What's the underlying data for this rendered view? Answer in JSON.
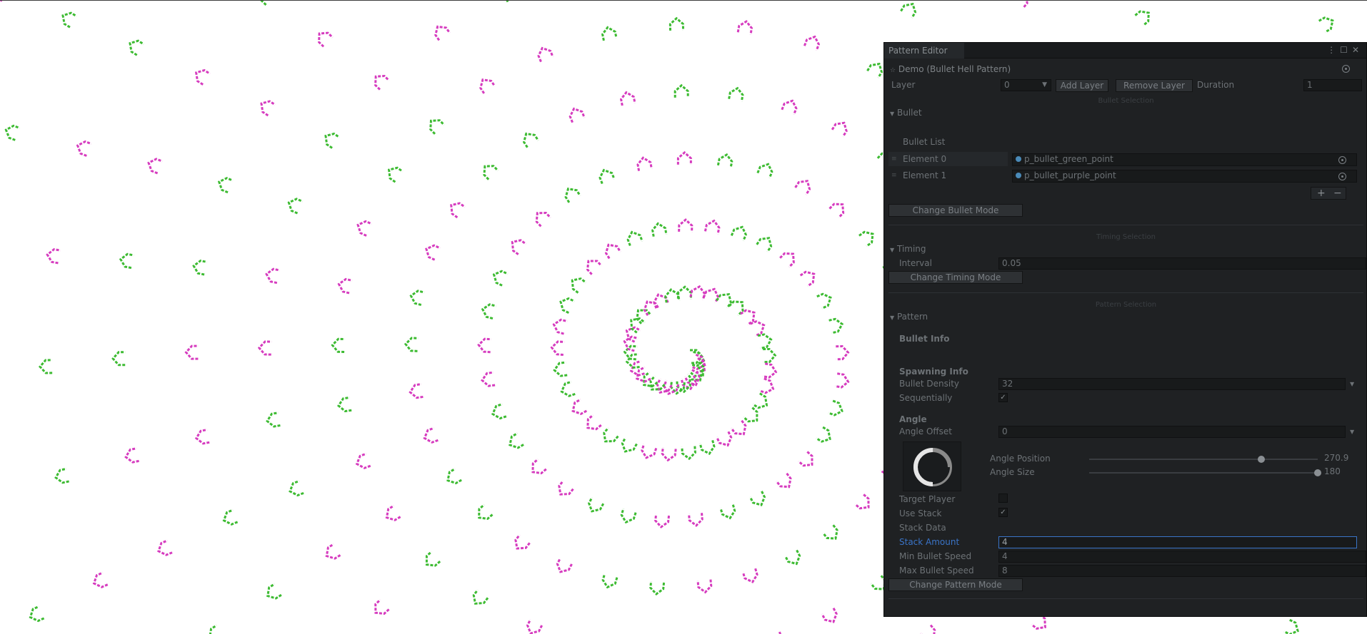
{
  "colors": {
    "green": "#3dbb32",
    "magenta": "#d63cbf",
    "panel_bg": "#1f2123",
    "accent": "#3a74c8"
  },
  "window": {
    "title": "Pattern Editor"
  },
  "asset": {
    "name": "Demo (Bullet Hell Pattern)"
  },
  "layer_row": {
    "label": "Layer",
    "value": "0",
    "add_label": "Add Layer",
    "remove_label": "Remove Layer",
    "duration_label": "Duration",
    "duration_value": "1"
  },
  "bullet_section": {
    "caption": "Bullet Selection",
    "foldout": "Bullet",
    "list_label": "Bullet List",
    "elements": [
      {
        "label": "Element 0",
        "value": "p_bullet_green_point"
      },
      {
        "label": "Element 1",
        "value": "p_bullet_purple_point"
      }
    ],
    "add": "+",
    "remove": "−",
    "mode_button": "Change Bullet Mode"
  },
  "timing_section": {
    "caption": "Timing Selection",
    "foldout": "Timing",
    "interval_label": "Interval",
    "interval_value": "0.05",
    "mode_button": "Change Timing Mode"
  },
  "pattern_section": {
    "caption": "Pattern Selection",
    "foldout": "Pattern",
    "bullet_info": "Bullet Info",
    "spawning_info": "Spawning Info",
    "density_label": "Bullet Density",
    "density_value": "32",
    "sequential_label": "Sequentially",
    "sequential_checked": true,
    "angle_header": "Angle",
    "angle_offset_label": "Angle Offset",
    "angle_offset_value": "0",
    "angle_position_label": "Angle Position",
    "angle_position_value": "270.9",
    "angle_size_label": "Angle Size",
    "angle_size_value": "180",
    "angle_position_fraction": 0.752,
    "angle_size_fraction": 1.0,
    "target_player_label": "Target Player",
    "target_player_checked": false,
    "use_stack_label": "Use Stack",
    "use_stack_checked": true,
    "stack_data_label": "Stack Data",
    "stack_amount_label": "Stack Amount",
    "stack_amount_value": "4",
    "min_speed_label": "Min Bullet Speed",
    "min_speed_value": "4",
    "max_speed_label": "Max Bullet Speed",
    "max_speed_value": "8",
    "mode_button": "Change Pattern Mode"
  }
}
